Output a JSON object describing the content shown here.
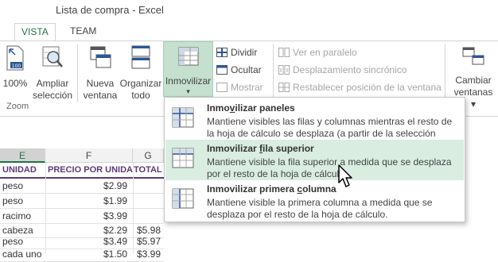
{
  "window": {
    "title": "Lista de compra - Excel"
  },
  "tabs": [
    {
      "label": "VISTA",
      "active": true
    },
    {
      "label": "TEAM",
      "active": false
    }
  ],
  "ribbon": {
    "zoom_label": "100%",
    "zoom_sel_label_1": "Ampliar",
    "zoom_sel_label_2": "selección",
    "group_zoom": "Zoom",
    "new_window_1": "Nueva",
    "new_window_2": "ventana",
    "arrange_1": "Organizar",
    "arrange_2": "todo",
    "freeze": "Inmovilizar",
    "freeze_arrow": "▾",
    "split": "Dividir",
    "hide": "Ocultar",
    "show": "Mostrar",
    "side_by_side": "Ver en paralelo",
    "sync_scroll": "Desplazamiento sincrónico",
    "reset_pos": "Restablecer posición de la ventana",
    "switch_1": "Cambiar",
    "switch_2": "ventanas ▾"
  },
  "grid": {
    "columns": [
      {
        "label": "E",
        "selected": true
      },
      {
        "label": "F",
        "selected": false
      },
      {
        "label": "G",
        "selected": false
      }
    ],
    "headers": [
      "UNIDAD",
      "PRECIO POR UNIDAD",
      "TOTAL"
    ],
    "rows": [
      [
        "peso",
        "$2.99",
        ""
      ],
      [
        "peso",
        "$1.99",
        ""
      ],
      [
        "racimo",
        "$3.99",
        ""
      ],
      [
        "cabeza",
        "$2.29",
        "$5.98"
      ],
      [
        "peso",
        "$3.49",
        "$5.97"
      ],
      [
        "cada uno",
        "$1.50",
        "$3.99"
      ]
    ]
  },
  "freeze_menu": {
    "items": [
      {
        "title_pre": "Inmo",
        "title_u": "v",
        "title_post": "ilizar paneles",
        "desc": "Mantiene visibles las filas y columnas mientras el resto de la hoja de cálculo se desplaza (a partir de la selección actual).",
        "highlighted": false
      },
      {
        "title_pre": "Inmovilizar ",
        "title_u": "f",
        "title_post": "ila superior",
        "desc": "Mantiene visible la fila superior a medida que se desplaza por el resto de la hoja de cálculo.",
        "highlighted": true
      },
      {
        "title_pre": "Inmovilizar primera ",
        "title_u": "c",
        "title_post": "olumna",
        "desc": "Mantiene visible la primera columna a medida que se desplaza por el resto de la hoja de cálculo.",
        "highlighted": false
      }
    ]
  },
  "colors": {
    "accent": "#217346",
    "header_text": "#5b3a78",
    "highlight": "#d9ede0"
  }
}
